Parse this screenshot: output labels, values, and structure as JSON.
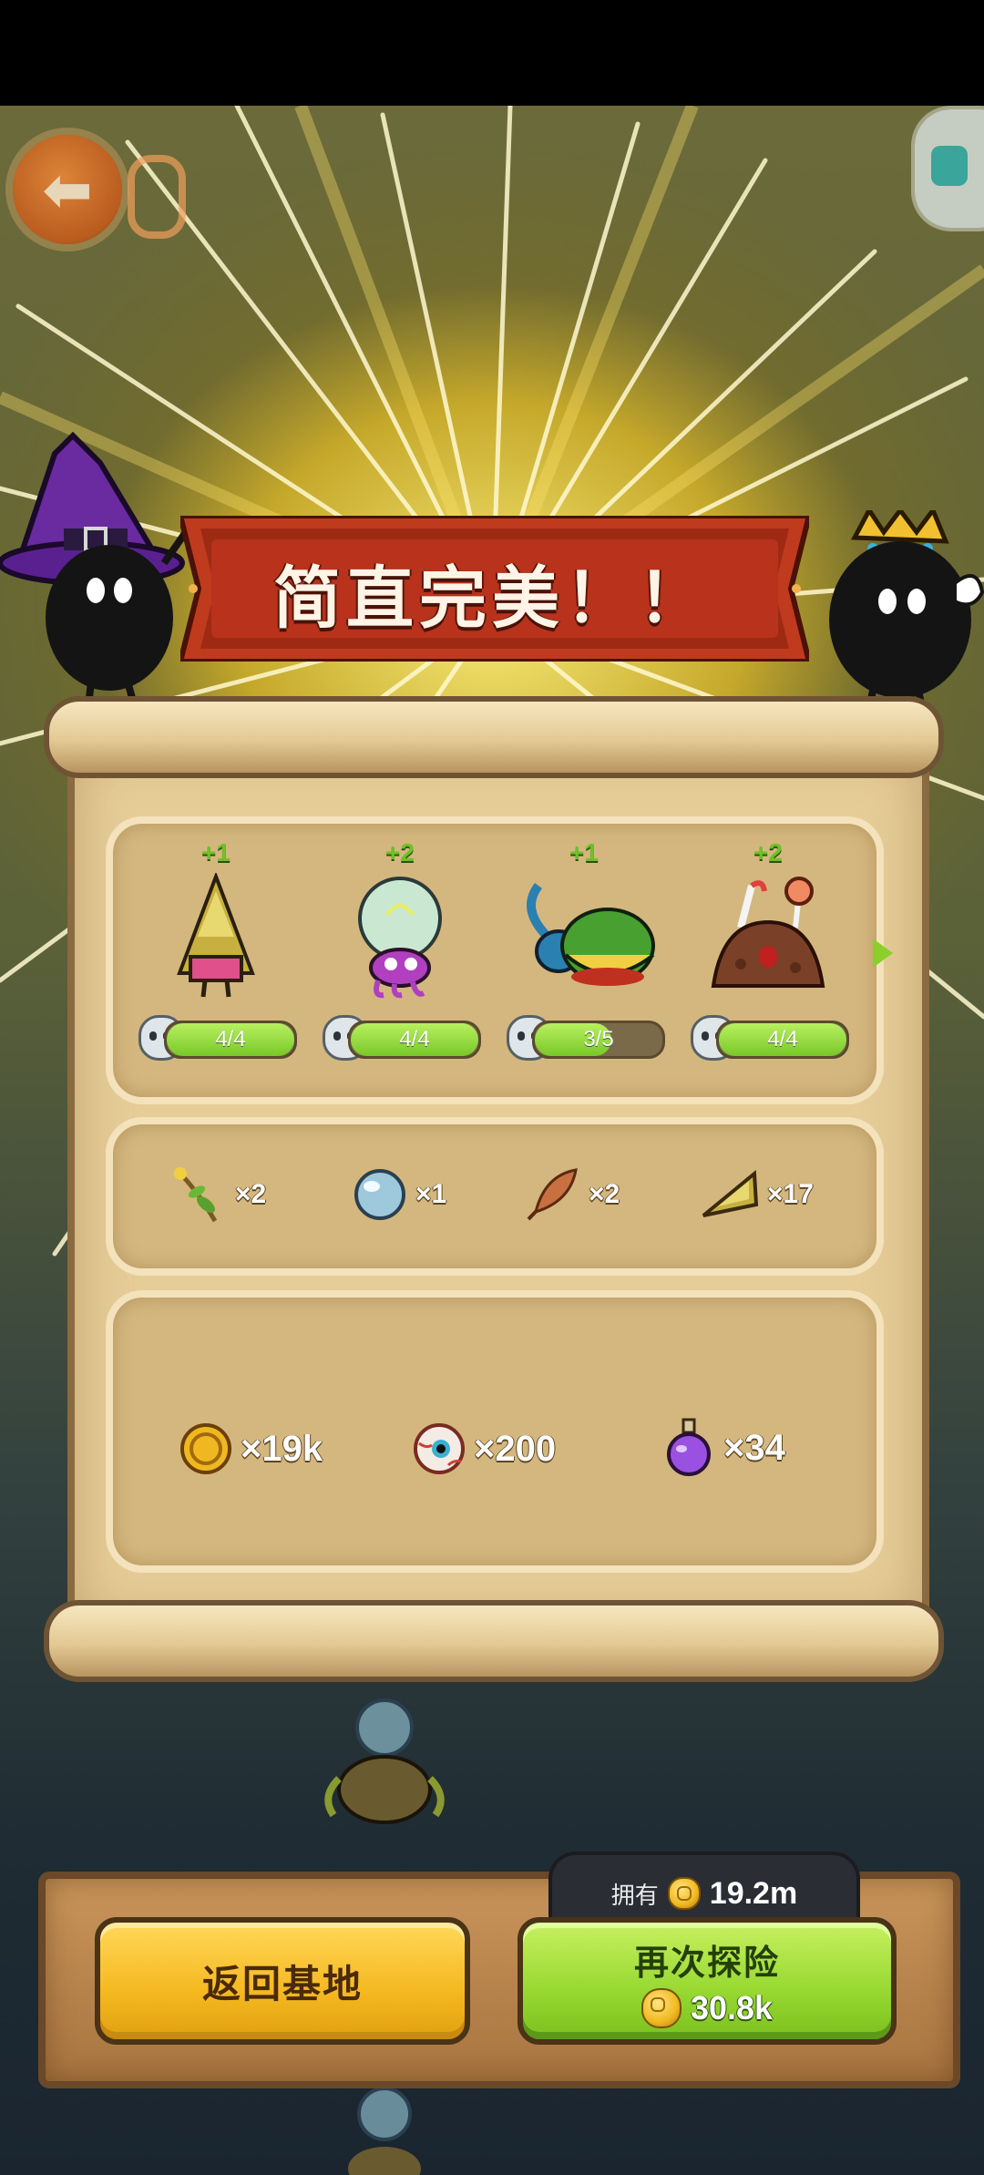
{
  "result": {
    "title": "简直完美！！"
  },
  "creatures": [
    {
      "name": "bamboo-shoot-creature",
      "gain": "+1",
      "progress": "4/4",
      "fill": 1.0
    },
    {
      "name": "lightbulb-octopus-creature",
      "gain": "+2",
      "progress": "4/4",
      "fill": 1.0
    },
    {
      "name": "beetle-creature",
      "gain": "+1",
      "progress": "3/5",
      "fill": 0.6
    },
    {
      "name": "candy-slime-creature",
      "gain": "+2",
      "progress": "4/4",
      "fill": 1.0
    }
  ],
  "materials": [
    {
      "icon": "herb-icon",
      "count": "×2"
    },
    {
      "icon": "pearl-icon",
      "count": "×1"
    },
    {
      "icon": "feather-icon",
      "count": "×2"
    },
    {
      "icon": "bamboo-shoot-icon",
      "count": "×17"
    }
  ],
  "currencies": [
    {
      "icon": "gold-coin-icon",
      "amount": "×19k"
    },
    {
      "icon": "eyeball-icon",
      "amount": "×200"
    },
    {
      "icon": "potion-icon",
      "amount": "×34"
    }
  ],
  "footer": {
    "owned_label": "拥有",
    "owned_value": "19.2m",
    "return_label": "返回基地",
    "explore_label": "再次探险",
    "explore_cost": "30.8k"
  },
  "colors": {
    "progress_fill": "#8cd83a",
    "gain_text": "#6ec028",
    "banner_red": "#b8321c",
    "parchment": "#e6cd98"
  }
}
